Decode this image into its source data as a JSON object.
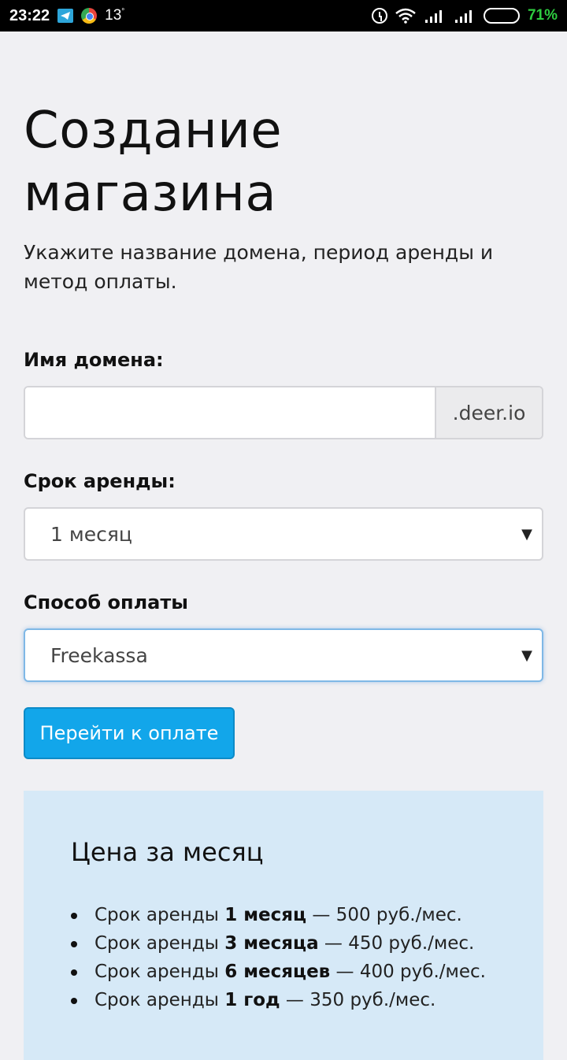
{
  "status_bar": {
    "time": "23:22",
    "temperature": "13",
    "temperature_unit": "°",
    "battery_percent": "71%",
    "icons": [
      "telegram-icon",
      "chrome-icon",
      "alarm-icon",
      "wifi-icon",
      "signal-icon",
      "signal-icon",
      "battery-icon"
    ]
  },
  "page": {
    "title": "Создание магазина",
    "subtitle": "Укажите название домена, период аренды и метод оплаты."
  },
  "form": {
    "domain_label": "Имя домена:",
    "domain_value": "",
    "domain_suffix": ".deer.io",
    "period_label": "Срок аренды:",
    "period_selected": "1 месяц",
    "payment_label": "Способ оплаты",
    "payment_selected": "Freekassa",
    "submit_label": "Перейти к оплате"
  },
  "pricing": {
    "title": "Цена за месяц",
    "items": [
      {
        "prefix": "Срок аренды ",
        "term": "1 месяц",
        "price": " — 500 руб./мес."
      },
      {
        "prefix": "Срок аренды ",
        "term": "3 месяца",
        "price": " — 450 руб./мес."
      },
      {
        "prefix": "Срок аренды ",
        "term": "6 месяцев",
        "price": " — 400 руб./мес."
      },
      {
        "prefix": "Срок аренды ",
        "term": "1 год",
        "price": " — 350 руб./мес."
      }
    ]
  },
  "colors": {
    "accent_button": "#12a6ea",
    "price_box_bg": "#d6e9f7",
    "page_bg": "#f0f0f3",
    "battery_text": "#2ecc40"
  }
}
